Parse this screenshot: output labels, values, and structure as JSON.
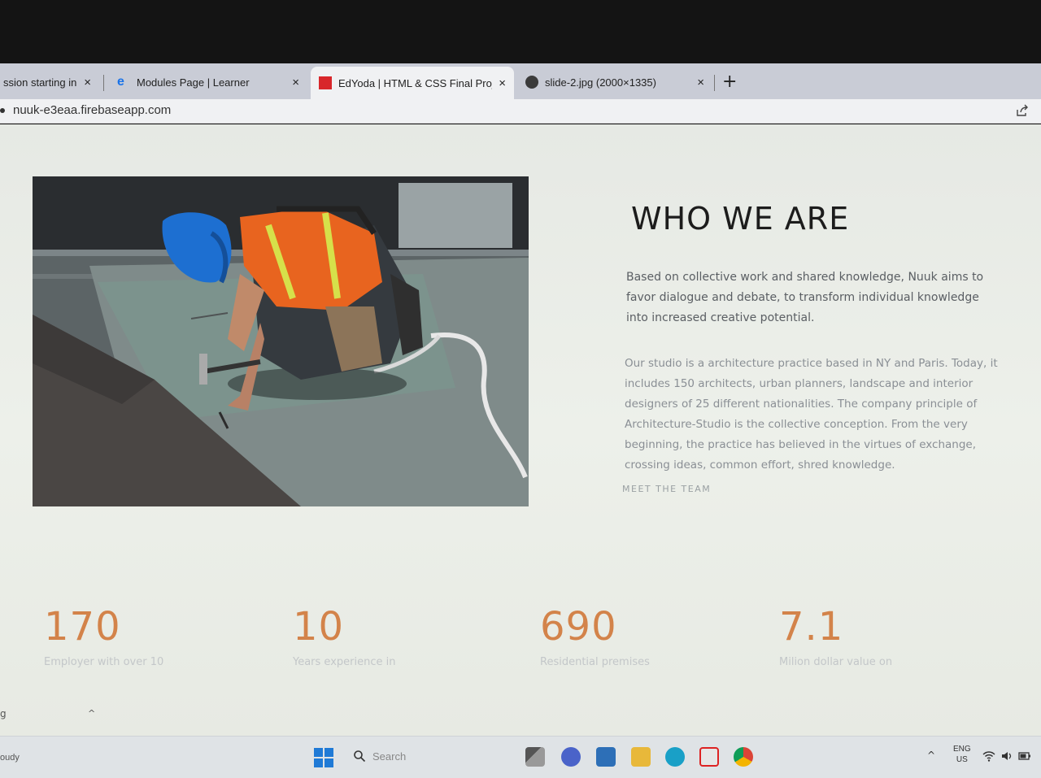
{
  "browser": {
    "tabs": [
      {
        "label": "ssion starting in",
        "favicon": "clock-icon",
        "active": false
      },
      {
        "label": "Modules Page | Learner",
        "favicon": "edge-e-icon",
        "active": false
      },
      {
        "label": "EdYoda | HTML & CSS Final Proje",
        "favicon": "red-square-icon",
        "active": true
      },
      {
        "label": "slide-2.jpg (2000×1335)",
        "favicon": "globe-icon",
        "active": false
      }
    ],
    "close_glyph": "×",
    "new_tab_glyph": "+",
    "url": "nuuk-e3eaa.firebaseapp.com"
  },
  "about": {
    "image_alt": "Construction worker with blue helmet hammering on a rooftop",
    "title": "WHO WE ARE",
    "lead": "Based on collective work and shared knowledge, Nuuk aims to favor dialogue and debate, to transform individual knowledge into increased creative potential.",
    "body": "Our studio is a architecture practice based in NY and Paris. Today, it includes 150 architects, urban planners, landscape and interior designers of 25 different nationalities. The company principle of Architecture-Studio is the collective conception. From the very beginning, the practice has believed in the virtues of exchange, crossing ideas, common effort, shred knowledge.",
    "link": "MEET THE TEAM"
  },
  "stats": [
    {
      "value": "170",
      "caption": "Employer with over 10"
    },
    {
      "value": "10",
      "caption": "Years experience in"
    },
    {
      "value": "690",
      "caption": "Residential premises"
    },
    {
      "value": "7.1",
      "caption": "Milion dollar value on"
    }
  ],
  "page_edge": {
    "left_glyph": "g",
    "caret": "^"
  },
  "taskbar": {
    "weather": "oudy",
    "search_placeholder": "Search",
    "lang_top": "ENG",
    "lang_bottom": "US",
    "tray_caret": "^"
  },
  "colors": {
    "accent": "#d3834a",
    "title": "#1c1c1c",
    "tab_active": "#f0f1f3",
    "tabstrip": "#c9ccd6"
  }
}
